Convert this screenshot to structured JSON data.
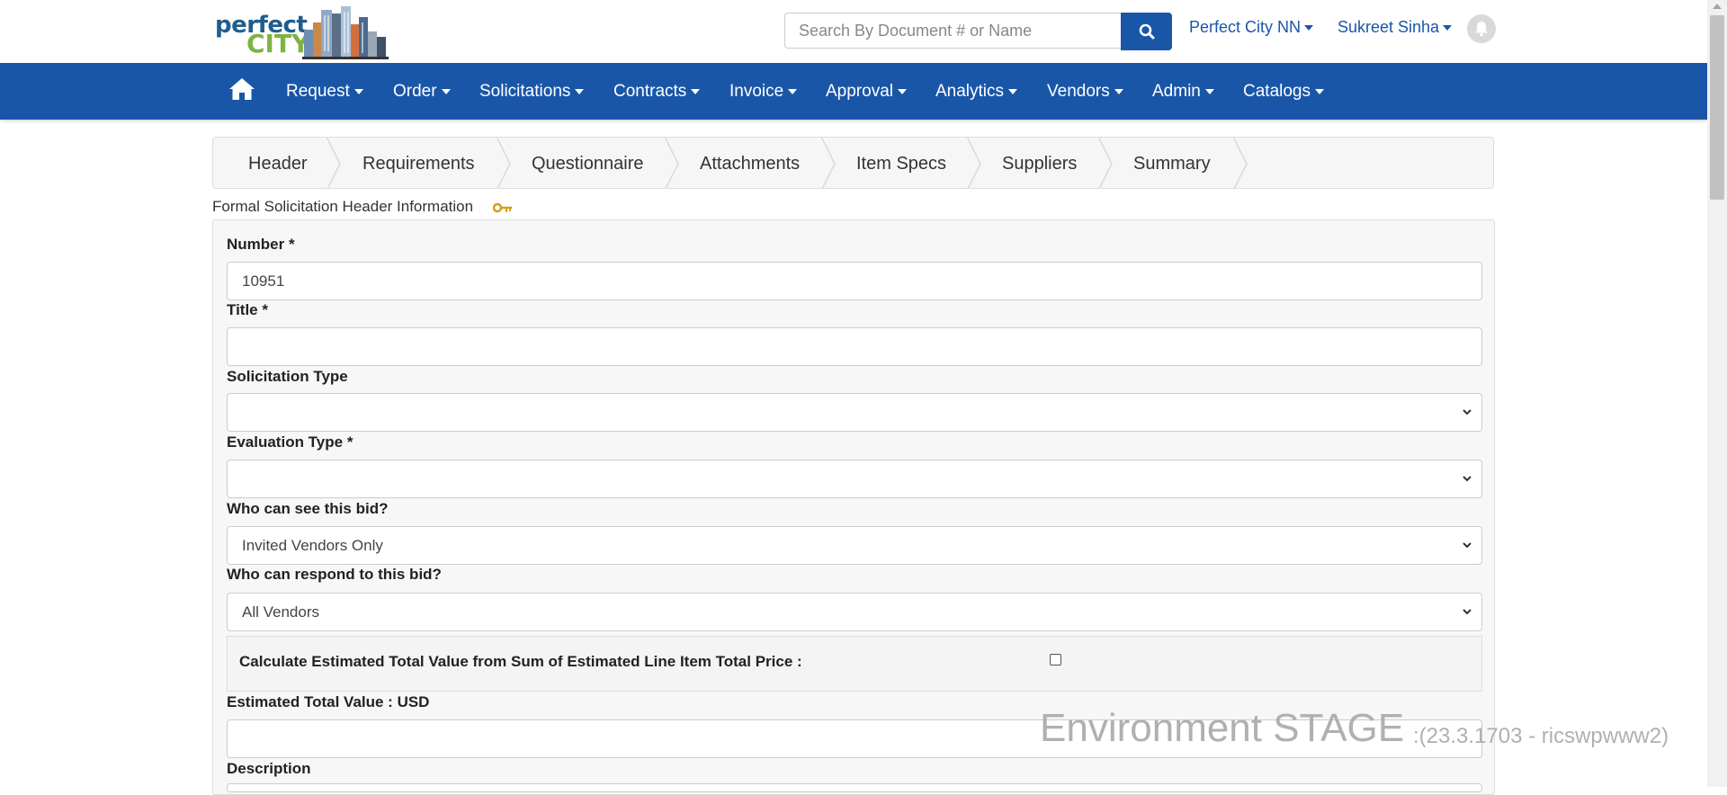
{
  "logo": {
    "line1": "perfect",
    "line2": "CITY"
  },
  "search": {
    "placeholder": "Search By Document # or Name"
  },
  "header": {
    "org_menu": "Perfect City NN",
    "user_menu": "Sukreet Sinha"
  },
  "nav": {
    "items": [
      "Request",
      "Order",
      "Solicitations",
      "Contracts",
      "Invoice",
      "Approval",
      "Analytics",
      "Vendors",
      "Admin",
      "Catalogs"
    ]
  },
  "steps": [
    "Header",
    "Requirements",
    "Questionnaire",
    "Attachments",
    "Item Specs",
    "Suppliers",
    "Summary"
  ],
  "form": {
    "section_title": "Formal Solicitation Header Information",
    "number_label": "Number *",
    "number_value": "10951",
    "title_label": "Title *",
    "title_value": "",
    "solicitation_type_label": "Solicitation Type",
    "solicitation_type_value": "",
    "evaluation_type_label": "Evaluation Type *",
    "evaluation_type_value": "",
    "visibility_label": "Who can see this bid?",
    "visibility_value": "Invited Vendors Only",
    "respond_label": "Who can respond to this bid?",
    "respond_value": "All Vendors",
    "calc_label": "Calculate Estimated Total Value from Sum of Estimated Line Item Total Price",
    "calc_colon": ":",
    "calc_checked": false,
    "est_total_label": "Estimated Total Value : USD",
    "est_total_value": "",
    "description_label": "Description"
  },
  "environment": {
    "main": "Environment STAGE",
    "sub": ":(23.3.1703 - ricswpwww2)"
  },
  "colors": {
    "brand_blue": "#1a56a8",
    "logo_green": "#7cb342",
    "logo_blue": "#1f5d8c"
  }
}
